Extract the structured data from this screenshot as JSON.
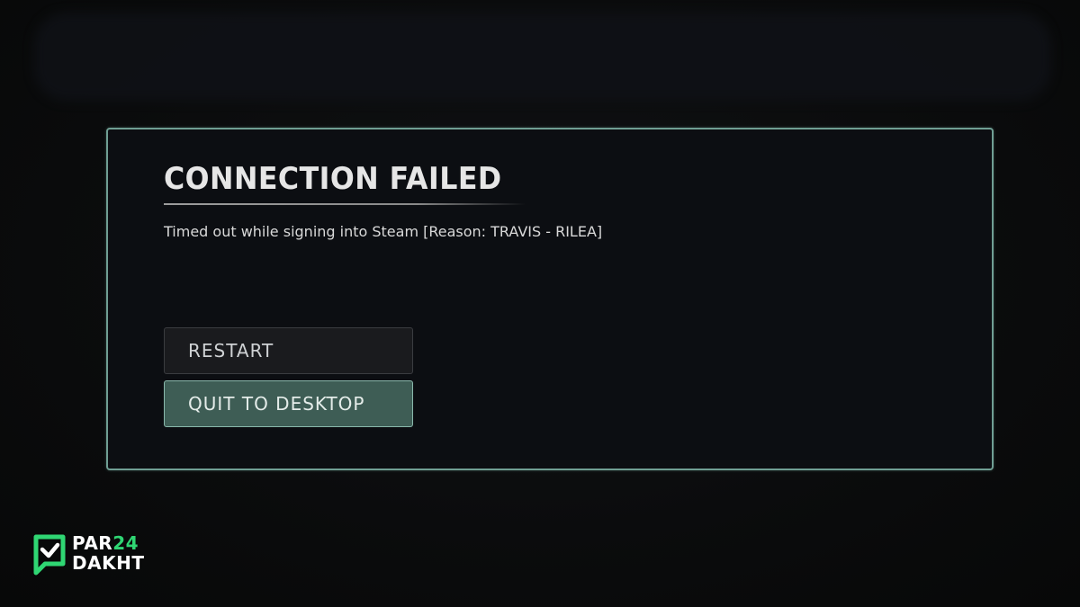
{
  "dialog": {
    "title": "CONNECTION FAILED",
    "message": "Timed out while signing into Steam [Reason: TRAVIS - RILEA]",
    "buttons": {
      "restart_label": "RESTART",
      "quit_label": "QUIT TO DESKTOP"
    }
  },
  "watermark": {
    "line1": "PAR",
    "line1_number": "24",
    "line2": "DAKHT",
    "icon": "chat-check-icon"
  },
  "colors": {
    "accent": "#8ab8ac",
    "quit_button_bg": "#3e5d55",
    "background": "#0b0c0c",
    "logo_green": "#2fd673"
  }
}
